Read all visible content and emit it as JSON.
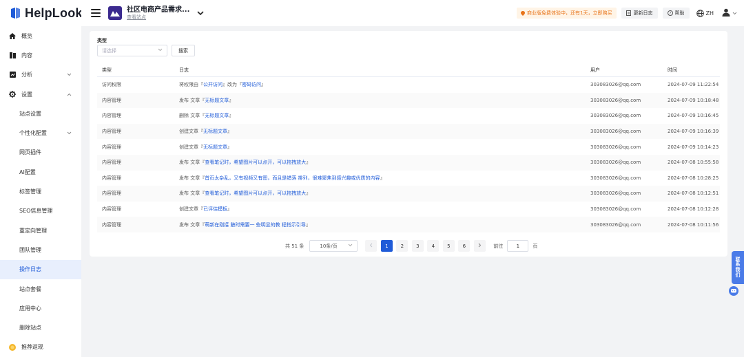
{
  "brand": {
    "name": "HelpLook",
    "color": "#1f5bd8"
  },
  "sidebar": {
    "items": [
      {
        "label": "概览",
        "icon": "home-icon"
      },
      {
        "label": "内容",
        "icon": "book-icon"
      },
      {
        "label": "分析",
        "icon": "chart-icon"
      },
      {
        "label": "设置",
        "icon": "gear-icon"
      },
      {
        "label": "站点设置"
      },
      {
        "label": "个性化配置"
      },
      {
        "label": "网页插件"
      },
      {
        "label": "AI配置"
      },
      {
        "label": "标签管理"
      },
      {
        "label": "SEO信息管理"
      },
      {
        "label": "重定向管理"
      },
      {
        "label": "团队管理"
      },
      {
        "label": "操作日志"
      },
      {
        "label": "站点套餐"
      },
      {
        "label": "应用中心"
      },
      {
        "label": "删除站点"
      },
      {
        "label": "推荐返现",
        "icon": "coin-icon"
      }
    ]
  },
  "header": {
    "site_name": "社区电商产品需求...",
    "site_link": "查看站点",
    "trial_text": "商业版免费体验中，还有1天，立即购买",
    "changelog": "更新日志",
    "help": "帮助",
    "lang": "ZH"
  },
  "filter": {
    "label": "类型",
    "placeholder": "请选择",
    "search_button": "搜索"
  },
  "table": {
    "headers": [
      "类型",
      "日志",
      "用户",
      "时间"
    ],
    "rows": [
      {
        "type": "访问权限",
        "log_pre": "将权限由『",
        "log_hl": "公开访问",
        "log_mid": "』改为『",
        "log_hl2": "密码访问",
        "log_post": "』",
        "user": "303083026@qq.com",
        "time": "2024-07-09 11:22:54"
      },
      {
        "type": "内容管理",
        "log_pre": "发布 文章『",
        "log_hl": "无标题文章",
        "log_mid": "",
        "log_hl2": "",
        "log_post": "』",
        "user": "303083026@qq.com",
        "time": "2024-07-09 10:18:48"
      },
      {
        "type": "内容管理",
        "log_pre": "删除 文章『",
        "log_hl": "无标题文章",
        "log_mid": "",
        "log_hl2": "",
        "log_post": "』",
        "user": "303083026@qq.com",
        "time": "2024-07-09 10:16:45"
      },
      {
        "type": "内容管理",
        "log_pre": "创建文章『",
        "log_hl": "无标题文章",
        "log_mid": "",
        "log_hl2": "",
        "log_post": "』",
        "user": "303083026@qq.com",
        "time": "2024-07-09 10:16:39"
      },
      {
        "type": "内容管理",
        "log_pre": "创建文章『",
        "log_hl": "无标题文章",
        "log_mid": "",
        "log_hl2": "",
        "log_post": "』",
        "user": "303083026@qq.com",
        "time": "2024-07-09 10:14:23"
      },
      {
        "type": "内容管理",
        "log_pre": "发布 文章『",
        "log_hl": "查看笔记时，希望图片可以点开，可以拖拽放大",
        "log_mid": "",
        "log_hl2": "",
        "log_post": "』",
        "user": "303083026@qq.com",
        "time": "2024-07-08 10:55:58"
      },
      {
        "type": "内容管理",
        "log_pre": "发布 文章『",
        "log_hl": "首页太杂乱，又有视频又有图，而且是错落 排列，很难聚焦到感兴趣或优质的内容",
        "log_mid": "",
        "log_hl2": "",
        "log_post": "』",
        "user": "303083026@qq.com",
        "time": "2024-07-08 10:28:25"
      },
      {
        "type": "内容管理",
        "log_pre": "发布 文章『",
        "log_hl": "查看笔记时，希望图片可以点开，可以拖拽放大",
        "log_mid": "",
        "log_hl2": "",
        "log_post": "』",
        "user": "303083026@qq.com",
        "time": "2024-07-08 10:12:51"
      },
      {
        "type": "内容管理",
        "log_pre": "创建文章『",
        "log_hl": "已评估模板",
        "log_mid": "",
        "log_hl2": "",
        "log_post": "』",
        "user": "303083026@qq.com",
        "time": "2024-07-08 10:12:28"
      },
      {
        "type": "内容管理",
        "log_pre": "发布 文章『",
        "log_hl": "萌新在刚接 触时需要一 些明显的教 程指示引导",
        "log_mid": "",
        "log_hl2": "",
        "log_post": "』",
        "user": "303083026@qq.com",
        "time": "2024-07-08 10:11:56"
      }
    ]
  },
  "pagination": {
    "total": "共 51 条",
    "page_size": "10条/页",
    "pages": [
      "1",
      "2",
      "3",
      "4",
      "5",
      "6"
    ],
    "current": "1",
    "goto_label": "前往",
    "goto_value": "1",
    "goto_suffix": "页"
  },
  "contact": {
    "label_chars": [
      "联",
      "系",
      "我",
      "们"
    ]
  }
}
